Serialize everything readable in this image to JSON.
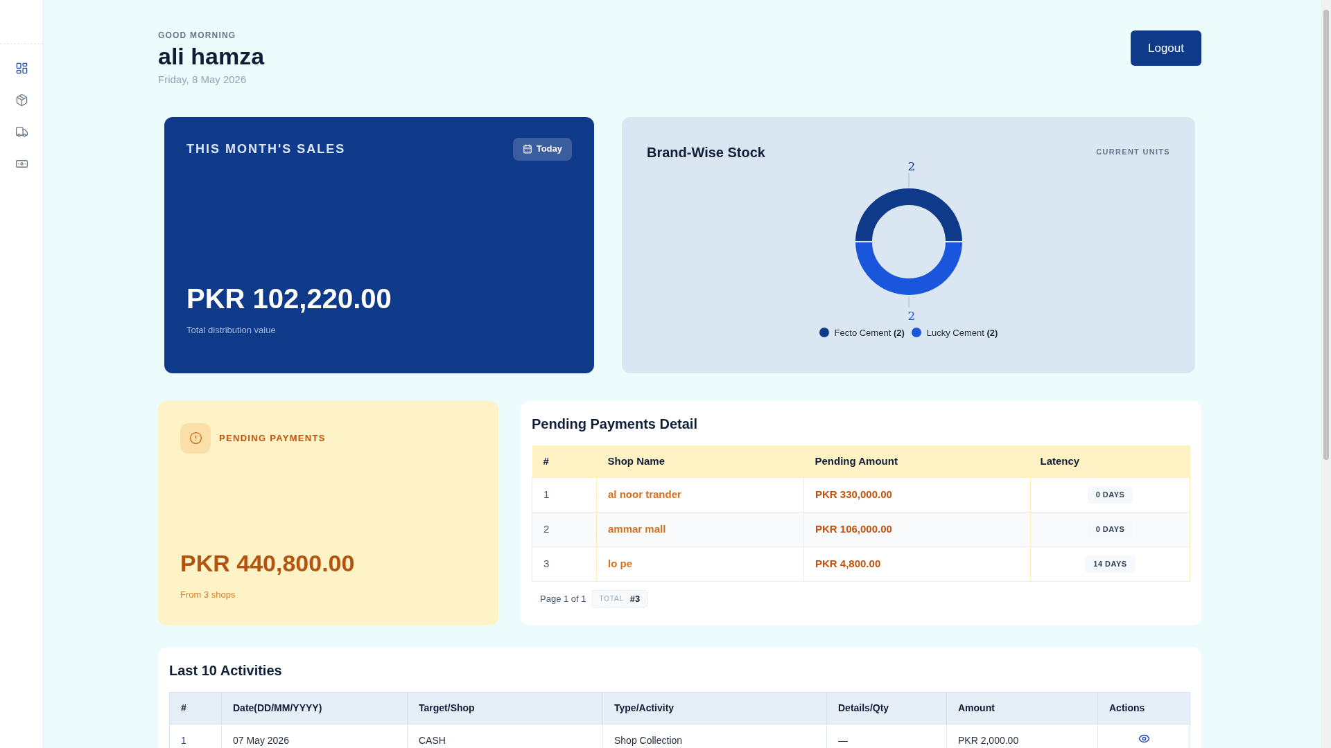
{
  "sidebar": {
    "items": [
      {
        "kind": "dashboard",
        "selected": true
      },
      {
        "kind": "products",
        "selected": false
      },
      {
        "kind": "deliveries",
        "selected": false
      },
      {
        "kind": "payments",
        "selected": false
      }
    ]
  },
  "header": {
    "greeting": "GOOD MORNING",
    "name": "ali hamza",
    "date": "Friday, 8 May 2026",
    "logout": "Logout"
  },
  "sales_card": {
    "title": "THIS MONTH'S SALES",
    "filter": "Today",
    "amount": "PKR 102,220.00",
    "caption": "Total distribution value"
  },
  "stock_card": {
    "title": "Brand-Wise Stock",
    "unit_label": "CURRENT UNITS",
    "chart_data": {
      "type": "donut",
      "categories": [
        "Fecto Cement",
        "Lucky Cement"
      ],
      "values": [
        2,
        2
      ],
      "data_labels": true
    },
    "legend": [
      {
        "count": "(2)",
        "color": "#0f3a8a"
      },
      {
        "count": "(2)",
        "color": "#1a56db"
      }
    ]
  },
  "pending_card": {
    "title": "PENDING PAYMENTS",
    "amount": "PKR 440,800.00",
    "caption": "From 3 shops"
  },
  "pending_table": {
    "title": "Pending Payments Detail",
    "columns": [
      "#",
      "Shop Name",
      "Pending Amount",
      "Latency"
    ],
    "rows": [
      [
        "1",
        "al noor trander",
        "PKR 330,000.00",
        "0 DAYS"
      ],
      [
        "2",
        "ammar mall",
        "PKR 106,000.00",
        "0 DAYS"
      ],
      [
        "3",
        "lo pe",
        "PKR 4,800.00",
        "14 DAYS"
      ]
    ],
    "page": "Page 1 of 1",
    "total_label": "TOTAL",
    "total": "#3"
  },
  "activities": {
    "title": "Last 10 Activities",
    "columns": [
      "#",
      "Date(DD/MM/YYYY)",
      "Target/Shop",
      "Type/Activity",
      "Details/Qty",
      "Amount",
      "Actions"
    ],
    "rows": [
      [
        "1",
        "07 May 2026",
        "CASH",
        "Shop Collection",
        "—",
        "PKR 2,000.00"
      ]
    ]
  }
}
